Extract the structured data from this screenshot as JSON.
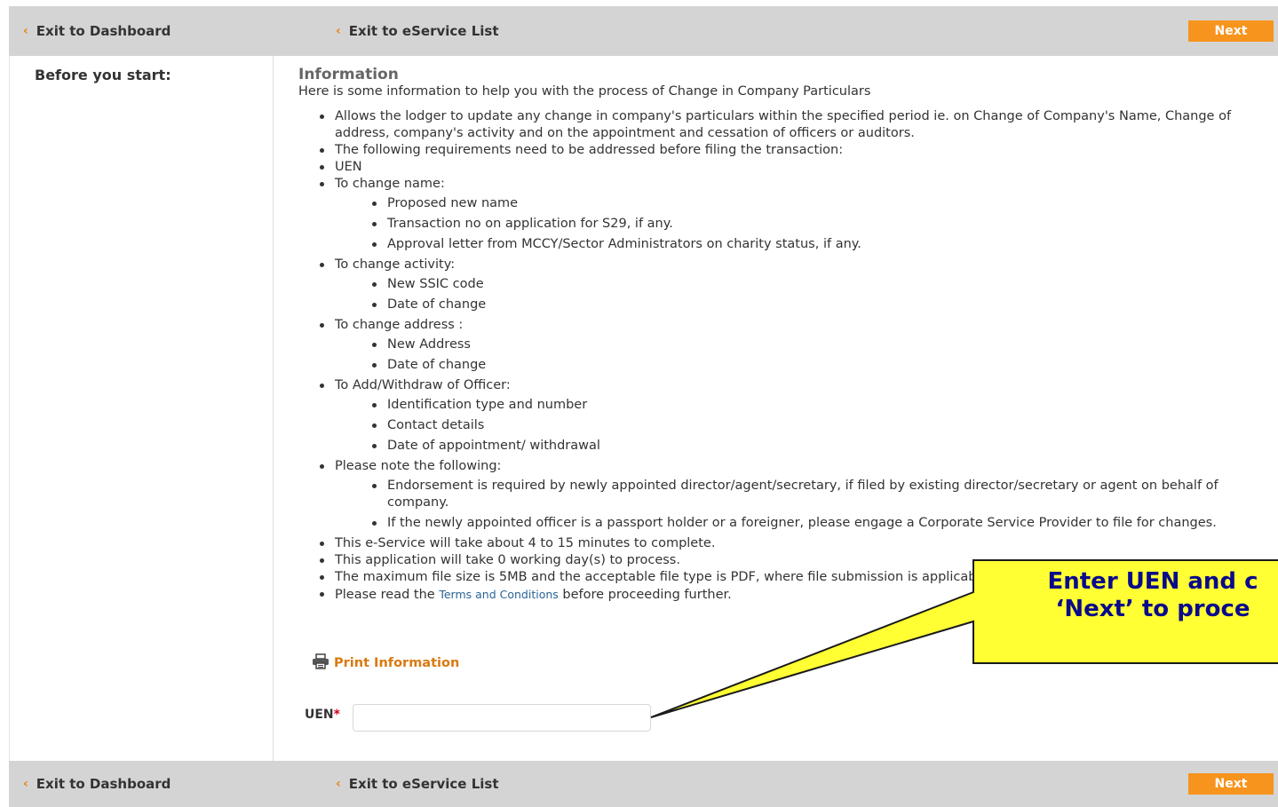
{
  "nav": {
    "exit_dashboard": "Exit to Dashboard",
    "exit_eservice": "Exit to eService List",
    "next": "Next"
  },
  "left": {
    "title": "Before you start:"
  },
  "info": {
    "heading": "Information",
    "intro": "Here is some information to help you with the process of Change in Company Particulars",
    "items": [
      "Allows the lodger to update any change in company's particulars within the specified period ie. on Change of Company's Name, Change of address, company's activity and on the appointment and cessation of officers or auditors.",
      "The following requirements need to be addressed before filing the transaction:",
      "UEN",
      "To change name:",
      "To change activity:",
      "To change address :",
      "To Add/Withdraw of Officer:",
      "Please note the following:",
      "This e-Service will take about 4 to 15 minutes to complete.",
      "This application will take 0 working day(s) to process.",
      "The maximum file size is 5MB and the acceptable file type is PDF, where file submission is applicable."
    ],
    "name_sub": [
      "Proposed new name",
      "Transaction no on application for S29, if any.",
      "Approval letter from MCCY/Sector Administrators on charity status, if any."
    ],
    "activity_sub": [
      "New SSIC code",
      "Date of change"
    ],
    "address_sub": [
      "New Address",
      "Date of change"
    ],
    "officer_sub": [
      "Identification type and number",
      "Contact details",
      "Date of appointment/ withdrawal"
    ],
    "note_sub": [
      "Endorsement is required by newly appointed director/agent/secretary, if filed by existing director/secretary or agent on behalf of company.",
      "If the newly appointed officer is a passport holder or a foreigner, please engage a Corporate Service Provider to file for changes."
    ],
    "read_prefix": "Please read the ",
    "terms_link": "Terms and Conditions",
    "read_suffix": " before proceeding further."
  },
  "print_label": "Print Information",
  "uen": {
    "label": "UEN",
    "required_mark": "*",
    "value": ""
  },
  "callout": {
    "line1": "Enter UEN and c",
    "line2": "‘Next’ to proce"
  },
  "colors": {
    "accent_orange": "#f7941d",
    "navbar_gray": "#d4d4d4",
    "callout_fill": "#ffff33",
    "callout_text": "#0a0a8a",
    "link_blue": "#2a6496"
  },
  "icons": {
    "chevron": "chevron-left-icon",
    "print": "printer-icon"
  }
}
